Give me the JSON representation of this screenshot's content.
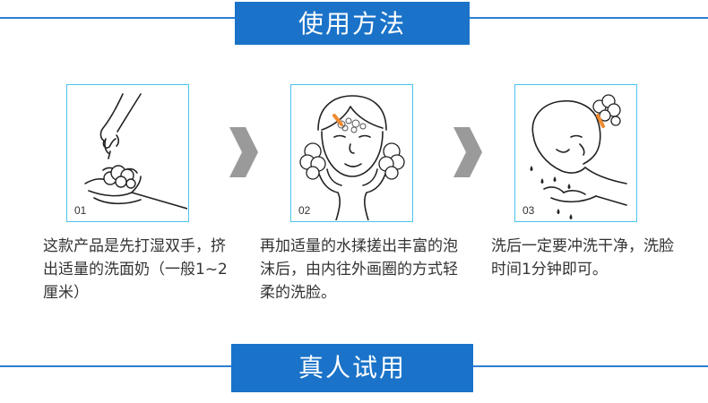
{
  "header_top": {
    "title": "使用方法",
    "accent_color": "#1a73c9"
  },
  "steps": [
    {
      "number": "01",
      "icon": "hand-foam-icon",
      "description": "这款产品是先打湿双手，挤出适量的洗面奶（一般1~2厘米）"
    },
    {
      "number": "02",
      "icon": "face-massage-icon",
      "description": "再加适量的水揉搓出丰富的泡沫后，由内往外画圈的方式轻柔的洗脸。"
    },
    {
      "number": "03",
      "icon": "face-rinse-icon",
      "description": "洗后一定要冲洗干净，洗脸时间1分钟即可。"
    }
  ],
  "header_bottom": {
    "title": "真人试用"
  },
  "colors": {
    "card_border": "#4dc3ee",
    "arrow": "#9a9a9a",
    "highlight": "#f08a30"
  }
}
